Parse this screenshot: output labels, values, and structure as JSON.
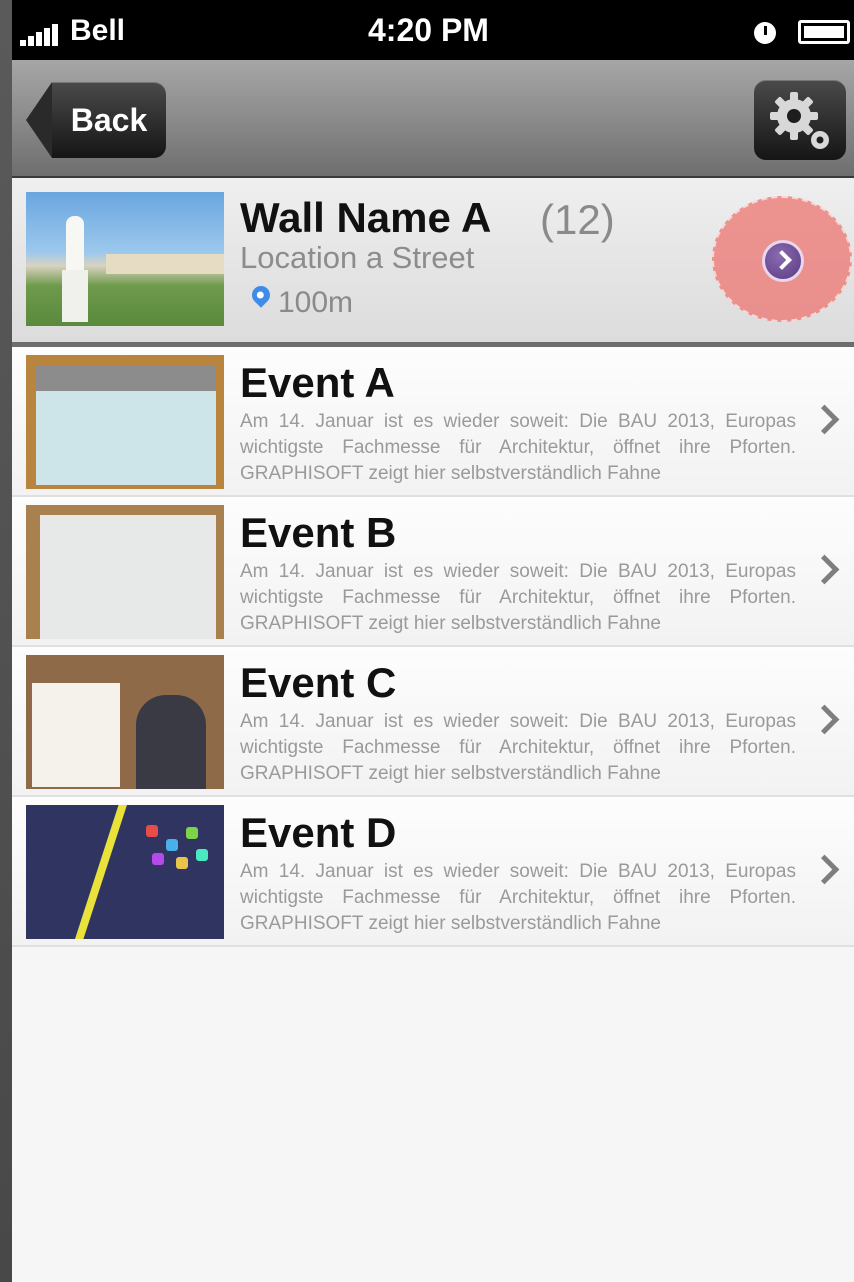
{
  "status_bar": {
    "carrier": "Bell",
    "time": "4:20 PM"
  },
  "nav": {
    "back_label": "Back",
    "settings_icon": "gear-icon"
  },
  "wall": {
    "title": "Wall Name A",
    "count": "(12)",
    "location": "Location a Street",
    "distance": "100m"
  },
  "events": [
    {
      "title": "Event A",
      "description": "Am 14. Januar ist es wieder soweit: Die BAU 2013, Europas wichtigste Fachmesse für Architektur, öffnet ihre Pforten. GRAPHISOFT zeigt hier selbstverständlich Fahne"
    },
    {
      "title": "Event B",
      "description": "Am 14. Januar ist es wieder soweit: Die BAU 2013, Europas wichtigste Fachmesse für Architektur, öffnet ihre Pforten. GRAPHISOFT zeigt hier selbstverständlich Fahne"
    },
    {
      "title": "Event C",
      "description": "Am 14. Januar ist es wieder soweit: Die BAU 2013, Europas wichtigste Fachmesse für Architektur, öffnet ihre Pforten. GRAPHISOFT zeigt hier selbstverständlich Fahne"
    },
    {
      "title": "Event D",
      "description": "Am 14. Januar ist es wieder soweit: Die BAU 2013, Europas wichtigste Fachmesse für Architektur, öffnet ihre Pforten. GRAPHISOFT zeigt hier selbstverständlich Fahne"
    }
  ],
  "colors": {
    "accent_pin": "#3f8be8",
    "highlight": "#ec7874"
  }
}
